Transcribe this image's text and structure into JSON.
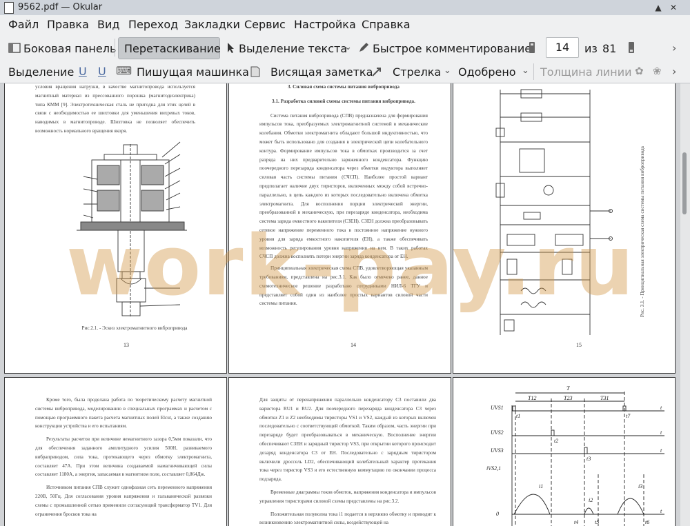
{
  "window": {
    "title": "9562.pdf — Okular"
  },
  "menu": [
    "Файл",
    "Правка",
    "Вид",
    "Переход",
    "Закладки",
    "Сервис",
    "Настройка",
    "Справка"
  ],
  "toolbar1": {
    "sidebar": "Боковая панель",
    "drag": "Перетаскивание",
    "text_select": "Выделение текста",
    "quick_comment": "Быстрое комментирование",
    "page": "14",
    "of": "из",
    "total": "81"
  },
  "toolbar2": {
    "select": "Выделение",
    "typewriter": "Пишущая машинка",
    "note": "Висящая заметка",
    "arrow": "Стрелка",
    "approved": "Одобрено",
    "line_width": "Толщина линии"
  },
  "watermark": "work-pay.ru",
  "pages": {
    "p13": {
      "number": "13",
      "text": "условия вращения нагрузки, в качестве магнитопровода используется магнитный материал из прессованного порошка (магнитодиэлектрика) типа КММ [9]. Электротехническая сталь не пригодна для этих целей в связи с необходимостью ее шихтовки для уменьшения вихревых токов, наводимых в магнитопроводе. Шихтовка не позволяет обеспечить возможность нормального вращения якоря.",
      "caption": "Рис.2.1. - Эскиз электромагнитного вибропривода"
    },
    "p14": {
      "number": "14",
      "heading": "3. Силовая схема системы питания вибропривода",
      "subheading": "3.1. Разработка силовой схемы системы питания вибропривода.",
      "para1": "Система питания вибропривода (СПВ) предназначена для формирования импульсов тока, преобразуемых электромагнитной системой в механические колебания. Обмотки электромагнита обладают большой индуктивностью, что может быть использовано для создания в электрической цепи колебательного контура. Формирование импульсов тока в обмотках производится за счет разряда на них предварительно заряженного конденсатора. Функцию поочередного перезаряда конденсатора через обмотки индуктора выполняет силовая часть системы питания (СЧСП). Наиболее простой вариант предполагает наличие двух тиристоров, включенных между собой встречно-параллельно, в цепь каждого из которых последовательно включена обмотка электромагнита. Для восполнения порции электрической энергии, преобразованной в механическую, при перезаряде конденсатора, необходима система заряда емкостного накопителя (СЗЕН). СЗЕН должна преобразовывать сетевое напряжение переменного тока в постоянное напряжение нужного уровня для заряда емкостного накопителя (ЕН), а также обеспечивать возможность регулирования уровня напряжения на нем. В таких работах СЧСП должна восполнять потери энергии заряда конденсатора от ЕН.",
      "para2": "Принципиальная электрическая схема СПВ, удовлетворяющая указанным требованиям, представлена на рис.3.1. Как было отмечено ранее, данное схемотехническое решение разработано сотрудниками НИЛ-6 ТГУ и представляет собой один из наиболее простых вариантов силовой части системы питания."
    },
    "p15": {
      "number": "15",
      "caption": "Рис. 3.1. - Принципиальная электрическая схема системы питания вибропривода"
    },
    "p16": {
      "para1": "Кроме того, была проделана работа по теоретическому расчету магнитной системы вибропривода, моделированию в специальных программах и расчетом с помощью программного пакета расчета магнитных полей Elcut, а также созданию конструкции устройства и его испытаниям.",
      "para2": "Результаты расчетов при величине немагнитного зазора 0,5мм показали, что для обеспечения заданного амплитудного усилия 500Н, развиваемого вибраприводом, сила тока, протекающего через обмотку электромагнита, составляет 47А. При этом величина создаваемой намагничивающей силы составляет 1180А, а энергия, запасаемая в магнитном поле, составляет 0,864Дж.",
      "para3": "Источником питания СПВ служит однофазная сеть переменного напряжения 220В, 50Гц. Для согласования уровня напряжения и гальванической развязки схемы с промышленной сетью применили согласующий трансформатор TV1. Для ограничения бросков тока на"
    },
    "p17": {
      "para1": "Для защиты от перенапряжения параллельно конденсатору С3 поставили два варистора RU1 и RU2. Для поочередного перезаряда конденсатора С3 через обмотки Z1 и Z2 необходимы тиристоры VS1 и VS2, каждый из которых включен последовательно с соответствующей обмоткой. Таким образом, часть энергии при перезаряде будет преобразовываться в механическую. Восполнение энергии обеспечивают СЗЕН и зарядный тиристор VS3, при открытии которого происходит дозаряд конденсатора С3 от ЕН. Последовательно с зарядным тиристором включили дроссель LD2, обеспечивающий колебательный характер протекания тока через тиристор VS3 и его естественную коммутацию по окончании процесса подзаряда.",
      "para2": "Временные диаграммы токов обмоток, напряжения конденсатора и импульсов управления тиристорами силовой схемы представлены на рис.3.2.",
      "para3": "Положительная полуволна тока i1 подается в верхнюю обмотку и приводит к возникновению электромагнитной силы, воздействующей на"
    },
    "p18": {
      "period": "T",
      "t12": "T12",
      "t23": "T23",
      "t31": "T31",
      "u1": "UVS1",
      "u2": "UVS2",
      "u3": "UVS3",
      "ivs": "iVS2,1",
      "axis_t": "t",
      "zero": "0",
      "t1": "t1",
      "t2": "t2",
      "t3": "t3",
      "t4": "t4",
      "t5": "t5",
      "t6": "t6",
      "t7": "t7",
      "l1": "i1",
      "l2": "i2",
      "l3": "i3"
    }
  }
}
